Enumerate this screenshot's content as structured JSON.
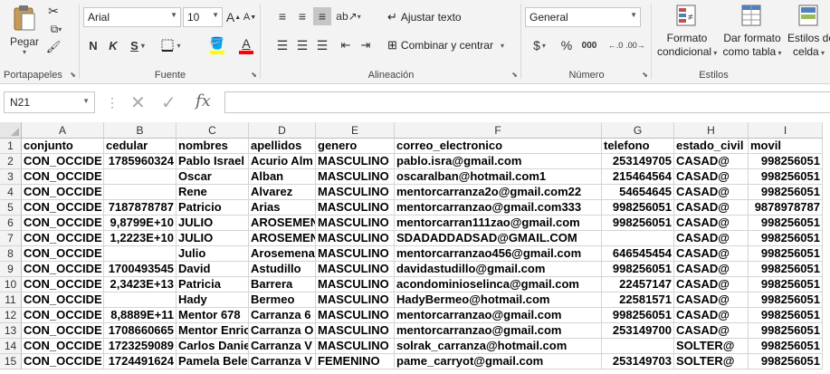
{
  "ribbon": {
    "portapapeles": {
      "label": "Portapapeles",
      "pegar": "Pegar"
    },
    "fuente": {
      "label": "Fuente",
      "font_name": "Arial",
      "font_size": "10",
      "bold": "N",
      "italic": "K",
      "underline": "S",
      "grow": "A",
      "shrink": "A"
    },
    "alineacion": {
      "label": "Alineación",
      "wrap": "Ajustar texto",
      "merge": "Combinar y centrar"
    },
    "numero": {
      "label": "Número",
      "format": "General",
      "currency": "$",
      "percent": "%",
      "thousands": "000"
    },
    "estilos": {
      "label": "Estilos",
      "cond_format": [
        "Formato",
        "condicional"
      ],
      "table_format": [
        "Dar formato",
        "como tabla"
      ],
      "cell_styles": [
        "Estilos de",
        "celda"
      ]
    }
  },
  "formula_bar": {
    "name_box": "N21",
    "fx": "fx",
    "formula": ""
  },
  "columns": [
    "A",
    "B",
    "C",
    "D",
    "E",
    "F",
    "G",
    "H",
    "I"
  ],
  "rows": [
    [
      "conjunto",
      "cedular",
      "nombres",
      "apellidos",
      "genero",
      "correo_electronico",
      "telefono",
      "estado_civil",
      "movil"
    ],
    [
      "CON_OCCIDE",
      "1785960324",
      "Pablo Israel",
      "Acurio Alm",
      "MASCULINO",
      "pablo.isra@gmail.com",
      "253149705",
      "CASAD@",
      "998256051"
    ],
    [
      "CON_OCCIDE",
      "",
      "Oscar",
      "Alban",
      "MASCULINO",
      "oscaralban@hotmail.com1",
      "215464564",
      "CASAD@",
      "998256051"
    ],
    [
      "CON_OCCIDE",
      "",
      "Rene",
      "Alvarez",
      "MASCULINO",
      "mentorcarranza2o@gmail.com22",
      "54654645",
      "CASAD@",
      "998256051"
    ],
    [
      "CON_OCCIDE",
      "7187878787",
      "Patricio",
      "Arias",
      "MASCULINO",
      "mentorcarranzao@gmail.com333",
      "998256051",
      "CASAD@",
      "9878978787"
    ],
    [
      "CON_OCCIDE",
      "9,8799E+10",
      "JULIO",
      "AROSEMEN",
      "MASCULINO",
      "mentorcarran111zao@gmail.com",
      "998256051",
      "CASAD@",
      "998256051"
    ],
    [
      "CON_OCCIDE",
      "1,2223E+10",
      "JULIO",
      "AROSEMEN",
      "MASCULINO",
      "SDADADDADSAD@GMAIL.COM",
      "",
      "CASAD@",
      "998256051"
    ],
    [
      "CON_OCCIDE",
      "",
      "Julio",
      "Arosemena",
      "MASCULINO",
      "mentorcarranzao456@gmail.com",
      "646545454",
      "CASAD@",
      "998256051"
    ],
    [
      "CON_OCCIDE",
      "1700493545",
      "David",
      "Astudillo",
      "MASCULINO",
      "davidastudillo@gmail.com",
      "998256051",
      "CASAD@",
      "998256051"
    ],
    [
      "CON_OCCIDE",
      "2,3423E+13",
      "Patricia",
      "Barrera",
      "MASCULINO",
      "acondominioselinca@gmail.com",
      "22457147",
      "CASAD@",
      "998256051"
    ],
    [
      "CON_OCCIDE",
      "",
      "Hady",
      "Bermeo",
      "MASCULINO",
      "HadyBermeo@hotmail.com",
      "22581571",
      "CASAD@",
      "998256051"
    ],
    [
      "CON_OCCIDE",
      "8,8889E+11",
      "Mentor 678",
      "Carranza 6",
      "MASCULINO",
      "mentorcarranzao@gmail.com",
      "998256051",
      "CASAD@",
      "998256051"
    ],
    [
      "CON_OCCIDE",
      "1708660665",
      "Mentor Enric",
      "Carranza O",
      "MASCULINO",
      "mentorcarranzao@gmail.com",
      "253149700",
      "CASAD@",
      "998256051"
    ],
    [
      "CON_OCCIDE",
      "1723259089",
      "Carlos Danie",
      "Carranza V",
      "MASCULINO",
      "solrak_carranza@hotmail.com",
      "",
      "SOLTER@",
      "998256051"
    ],
    [
      "CON_OCCIDE",
      "1724491624",
      "Pamela Bele",
      "Carranza V",
      "FEMENINO",
      "pame_carryot@gmail.com",
      "253149703",
      "SOLTER@",
      "998256051"
    ]
  ],
  "colors": {
    "fill_color": "#ffff00",
    "font_color": "#ff0000",
    "selected_align": "#c6c6c6"
  }
}
